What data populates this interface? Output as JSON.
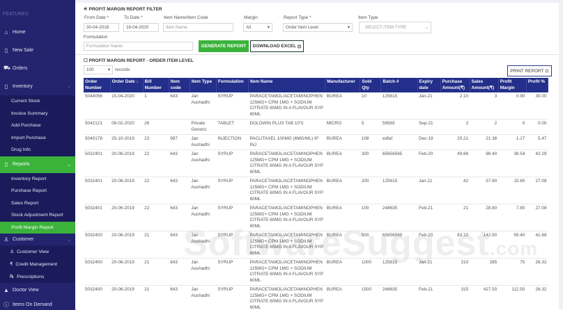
{
  "sidebar": {
    "section": "FEATURES",
    "items": [
      {
        "label": "Home",
        "icon": "home-icon",
        "glyph": "⌂"
      },
      {
        "label": "New Sale",
        "icon": "clipboard-icon",
        "glyph": "▯"
      },
      {
        "label": "Orders",
        "icon": "cart-icon",
        "glyph": "⛟"
      },
      {
        "label": "Inventory",
        "icon": "box-icon",
        "glyph": "▯"
      }
    ],
    "inventory_sub": [
      "Current Stock",
      "Invoice Summary",
      "Add Purchase",
      "Import Purchase",
      "Drug Info"
    ],
    "reports": {
      "label": "Reports",
      "glyph": "▯"
    },
    "reports_sub": [
      "Inventory Report",
      "Purchase Report",
      "Sales Report",
      "Stock Adjustment Report",
      "Profit Margin Report"
    ],
    "customer": {
      "label": "Customer",
      "glyph": "♙"
    },
    "customer_sub": [
      {
        "label": "Customer View",
        "glyph": "♙"
      },
      {
        "label": "Credit Management",
        "glyph": "₹"
      },
      {
        "label": "Prescriptions",
        "glyph": "℞"
      }
    ],
    "bottom": [
      {
        "label": "Doctor View",
        "glyph": "▲"
      },
      {
        "label": "Items On Demand",
        "glyph": "ⓘ"
      }
    ]
  },
  "filter": {
    "title": "PROFIT MARGIN REPORT FILTER",
    "from_label": "From Date *",
    "from": "30-04-2018",
    "to_label": "To Date *",
    "to": "16-04-2020",
    "item_label": "Item Name/Item Code",
    "item_ph": "Item Name",
    "margin_label": "Margin",
    "margin": "All",
    "rtype_label": "Report Type *",
    "rtype": "Order Item Level",
    "itype_label": "Item Type",
    "itype_ph": "SELECT ITEM TYPE",
    "form_label": "Formulation",
    "form_ph": "Formulation Name",
    "generate": "GENERATE REPORT",
    "download": "DOWNLOAD EXCEL"
  },
  "report": {
    "title": "PROFIT MARGIN REPORT - ORDER ITEM LEVEL",
    "records": "100",
    "records_label": "records",
    "print": "PRINT REPORT",
    "columns": [
      "Order Number",
      "Order Date ↓",
      "Bill Number",
      "Item code",
      "Item Type",
      "Formulation",
      "Item Name",
      "Manufacturer",
      "Sold Qty",
      "Batch #",
      "Expiry date",
      "Purchase Amount(₹)",
      "Sales Amount(₹)",
      "Profit Margin",
      "Profit %"
    ],
    "rows": [
      [
        "5044056",
        "15-04-2020",
        "1",
        "643",
        "Jan Aushadhi",
        "SYRUP",
        "PARACETAMOL/ACETAMINOPHEN 125MG+ CPM 1MG + SODIUM CITRATE 60MG IN A FLAVOUR SYP 60ML",
        "BUREA",
        "10",
        "125615",
        "Jan-21",
        "2.10",
        "3",
        "0.90",
        "30.00"
      ],
      [
        "5042121",
        "06-02-2020",
        "26",
        "",
        "Private Generic",
        "TABLET",
        "DOLOWIN PLUS TAB 10'S",
        "MICRO",
        "5",
        "56565",
        "Sep-21",
        "2",
        "2",
        "0",
        "0.00"
      ],
      [
        "5040178",
        "25-10-2019",
        "23",
        "997",
        "Jan Aushadhi",
        "INJECTION",
        "PACLITAXEL 100MG (6MG/ML) IP INJ",
        "BUREA",
        "108",
        "edfaf",
        "Dec-19",
        "20.21",
        "21.38",
        "1.17",
        "5.47"
      ],
      [
        "5032401",
        "20-06-2019",
        "22",
        "643",
        "Jan Aushadhi",
        "SYRUP",
        "PARACETAMOL/ACETAMINOPHEN 125MG+ CPM 1MG + SODIUM CITRATE 60MG IN A FLAVOUR SYP 60ML",
        "BUREA",
        "300",
        "65656565",
        "Feb-20",
        "49.86",
        "86.40",
        "36.54",
        "42.29"
      ],
      [
        "5032401",
        "20-06-2019",
        "22",
        "643",
        "Jan Aushadhi",
        "SYRUP",
        "PARACETAMOL/ACETAMINOPHEN 125MG+ CPM 1MG + SODIUM CITRATE 60MG IN A FLAVOUR SYP 60ML",
        "BUREA",
        "200",
        "125615",
        "Jan-21",
        "42",
        "57.60",
        "15.60",
        "27.08"
      ],
      [
        "5032401",
        "20-06-2019",
        "22",
        "643",
        "Jan Aushadhi",
        "SYRUP",
        "PARACETAMOL/ACETAMINOPHEN 125MG+ CPM 1MG + SODIUM CITRATE 60MG IN A FLAVOUR SYP 60ML",
        "BUREA",
        "100",
        "248635",
        "Feb-21",
        "21",
        "28.80",
        "7.80",
        "27.08"
      ],
      [
        "5032400",
        "20-06-2019",
        "21",
        "643",
        "Jan Aushadhi",
        "SYRUP",
        "PARACETAMOL/ACETAMINOPHEN 125MG+ CPM 1MG + SODIUM CITRATE 60MG IN A FLAVOUR SYP 60ML",
        "BUREA",
        "500",
        "65656565",
        "Feb-20",
        "83.10",
        "142.50",
        "59.40",
        "41.68"
      ],
      [
        "5032400",
        "20-06-2019",
        "21",
        "643",
        "Jan Aushadhi",
        "SYRUP",
        "PARACETAMOL/ACETAMINOPHEN 125MG+ CPM 1MG + SODIUM CITRATE 60MG IN A FLAVOUR SYP 60ML",
        "BUREA",
        "1000",
        "125615",
        "Jan-21",
        "210",
        "285",
        "75",
        "26.32"
      ],
      [
        "5032400",
        "20-06-2019",
        "21",
        "643",
        "Jan Aushadhi",
        "SYRUP",
        "PARACETAMOL/ACETAMINOPHEN 125MG+ CPM 1MG + SODIUM CITRATE 60MG IN A FLAVOUR SYP 60ML",
        "BUREA",
        "1500",
        "248635",
        "Feb-21",
        "315",
        "427.50",
        "112.50",
        "26.32"
      ]
    ]
  },
  "watermark": {
    "main": "SoftwareSuggest",
    "suffix": ".com"
  }
}
